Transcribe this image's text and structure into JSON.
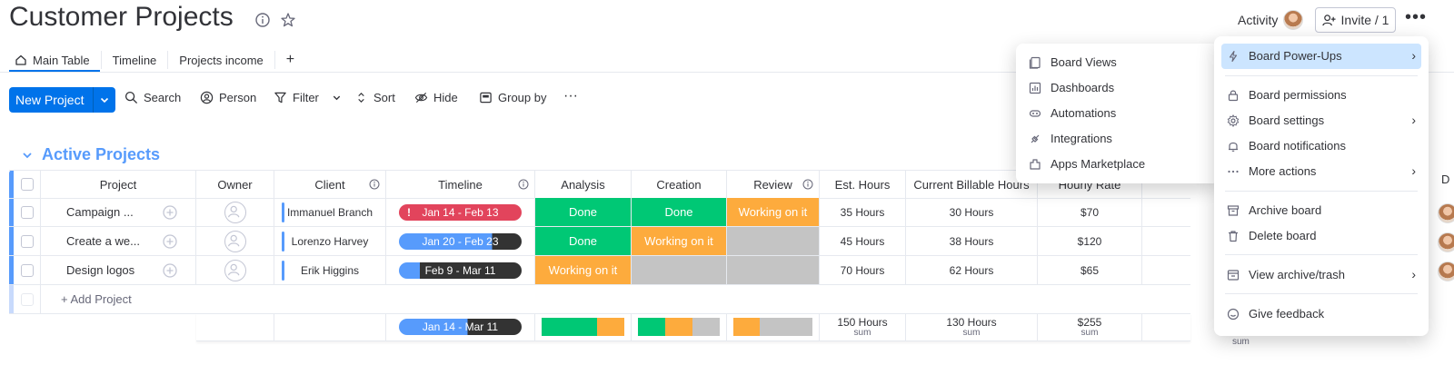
{
  "header": {
    "title": "Customer Projects",
    "activity_label": "Activity",
    "invite_label": "Invite / 1"
  },
  "tabs": [
    {
      "label": "Main Table"
    },
    {
      "label": "Timeline"
    },
    {
      "label": "Projects income"
    },
    {
      "label": "+"
    }
  ],
  "toolbar": {
    "new_project": "New Project",
    "search": "Search",
    "person": "Person",
    "filter": "Filter",
    "sort": "Sort",
    "hide": "Hide",
    "group_by": "Group by"
  },
  "group": {
    "title": "Active Projects"
  },
  "columns": {
    "project": "Project",
    "owner": "Owner",
    "client": "Client",
    "timeline": "Timeline",
    "analysis": "Analysis",
    "creation": "Creation",
    "review": "Review",
    "est_hours": "Est. Hours",
    "billable": "Current Billable Hours",
    "rate": "Hourly Rate"
  },
  "rows": [
    {
      "project": "Campaign ...",
      "client": "Immanuel Branch",
      "timeline": "Jan 14 - Feb 13",
      "analysis": "Done",
      "creation": "Done",
      "review": "Working on it",
      "est_hours": "35 Hours",
      "billable": "30 Hours",
      "rate": "$70"
    },
    {
      "project": "Create a we...",
      "client": "Lorenzo Harvey",
      "timeline": "Jan 20 - Feb 23",
      "analysis": "Done",
      "creation": "Working on it",
      "review": "",
      "est_hours": "45 Hours",
      "billable": "38 Hours",
      "rate": "$120"
    },
    {
      "project": "Design logos",
      "client": "Erik Higgins",
      "timeline": "Feb 9 - Mar 11",
      "analysis": "Working on it",
      "creation": "",
      "review": "",
      "est_hours": "70 Hours",
      "billable": "62 Hours",
      "rate": "$65"
    }
  ],
  "add_project": "+ Add Project",
  "summary": {
    "timeline": "Jan 14 - Mar 11",
    "est_hours": "150 Hours",
    "billable": "130 Hours",
    "rate": "$255",
    "sum_label": "sum",
    "hidden_sum": "sum"
  },
  "colors": {
    "done": "#00c875",
    "working": "#fdab3d",
    "empty": "#c4c4c4",
    "stuck": "#e2445c",
    "primary": "#0073ea",
    "group": "#579bfc"
  },
  "board_views_menu": [
    {
      "label": "Board Views",
      "icon": "board-views-icon"
    },
    {
      "label": "Dashboards",
      "icon": "dashboards-icon"
    },
    {
      "label": "Automations",
      "icon": "automations-icon"
    },
    {
      "label": "Integrations",
      "icon": "integrations-icon"
    },
    {
      "label": "Apps Marketplace",
      "icon": "apps-marketplace-icon"
    }
  ],
  "main_menu": [
    {
      "label": "Board Power-Ups",
      "icon": "lightning-icon"
    },
    {
      "label": "Board permissions",
      "icon": "lock-icon"
    },
    {
      "label": "Board settings",
      "icon": "gear-icon"
    },
    {
      "label": "Board notifications",
      "icon": "bell-icon"
    },
    {
      "label": "More actions",
      "icon": "dots-icon"
    },
    {
      "label": "Archive board",
      "icon": "archive-icon"
    },
    {
      "label": "Delete board",
      "icon": "trash-icon"
    },
    {
      "label": "View archive/trash",
      "icon": "archive-trash-icon"
    },
    {
      "label": "Give feedback",
      "icon": "feedback-icon"
    }
  ],
  "edge_column_initial": "D"
}
